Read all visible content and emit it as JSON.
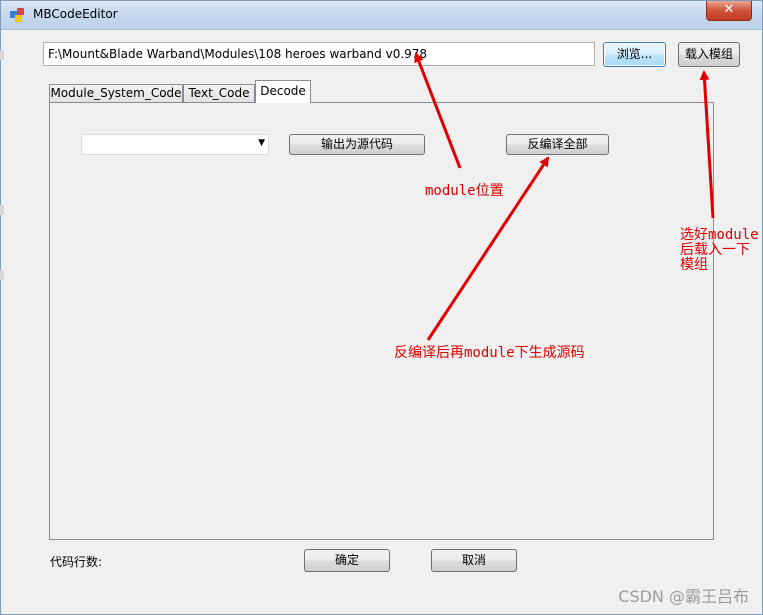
{
  "window": {
    "title": "MBCodeEditor",
    "close_label": "✕"
  },
  "toolbar": {
    "path_value": "F:\\Mount&Blade Warband\\Modules\\108 heroes warband v0.978",
    "browse_label": "浏览...",
    "load_label": "载入模组"
  },
  "tabs": [
    {
      "label": "Module_System_Code",
      "active": false
    },
    {
      "label": "Text_Code",
      "active": false
    },
    {
      "label": "Decode",
      "active": true
    }
  ],
  "decode": {
    "combo_value": "",
    "export_label": "输出为源代码",
    "decompile_label": "反编译全部"
  },
  "footer": {
    "line_count_label": "代码行数:",
    "ok_label": "确定",
    "cancel_label": "取消"
  },
  "annotations": {
    "module_location": "module位置",
    "load_hint": [
      "选好module",
      "后载入一下",
      "模组"
    ],
    "decompile_hint": "反编译后再module下生成源码",
    "color": "#e00000"
  },
  "watermark": "CSDN @霸王吕布",
  "icons": {
    "app": "app-cube-icon",
    "combo": "dropdown-arrow-icon"
  }
}
